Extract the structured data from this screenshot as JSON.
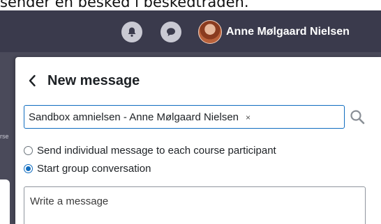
{
  "caption": "sender en besked i beskedtråden.",
  "header": {
    "notifications_icon": "bell-icon",
    "messages_icon": "chat-bubble-icon",
    "user_name": "Anne Mølgaard Nielsen"
  },
  "background": {
    "fragment": "rse"
  },
  "drawer": {
    "back_icon": "chevron-left-icon",
    "title": "New message",
    "recipients": [
      {
        "label": "Sandbox amnielsen - Anne Mølgaard Nielsen",
        "remove": "×"
      }
    ],
    "search_icon": "search-icon",
    "options": [
      {
        "label": "Send individual message to each course participant",
        "selected": false
      },
      {
        "label": "Start group conversation",
        "selected": true
      }
    ],
    "message_placeholder": "Write a message"
  },
  "colors": {
    "navbar": "#3a3a4c",
    "accent": "#0f6cbf",
    "backdrop": "#4a4a5a"
  }
}
